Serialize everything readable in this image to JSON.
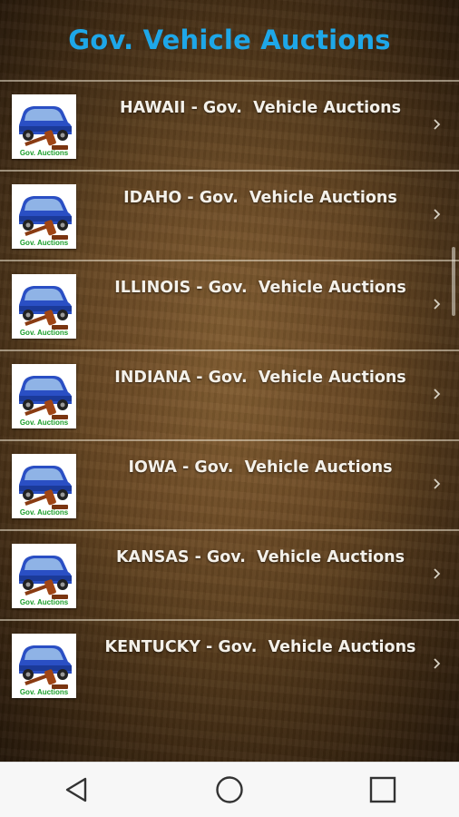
{
  "header": {
    "title": "Gov. Vehicle Auctions"
  },
  "items": [
    {
      "label": "HAWAII - Gov.  Vehicle Auctions",
      "thumb_text": "Gov. Auctions"
    },
    {
      "label": "IDAHO - Gov.  Vehicle Auctions",
      "thumb_text": "Gov. Auctions"
    },
    {
      "label": "ILLINOIS - Gov.  Vehicle Auctions",
      "thumb_text": "Gov. Auctions"
    },
    {
      "label": "INDIANA - Gov.  Vehicle Auctions",
      "thumb_text": "Gov. Auctions"
    },
    {
      "label": "IOWA - Gov.  Vehicle Auctions",
      "thumb_text": "Gov. Auctions"
    },
    {
      "label": "KANSAS - Gov.  Vehicle Auctions",
      "thumb_text": "Gov. Auctions"
    },
    {
      "label": "KENTUCKY - Gov.  Vehicle Auctions",
      "thumb_text": "Gov. Auctions"
    }
  ],
  "icons": {
    "row_chevron": "chevron-right-icon",
    "thumbnail": "car-gavel-icon",
    "nav_back": "back-triangle-icon",
    "nav_home": "home-circle-icon",
    "nav_recents": "recents-square-icon"
  },
  "colors": {
    "title": "#1ea7e8",
    "row_text": "#f4f1ea",
    "thumb_label": "#1a9e2a",
    "navbar": "#f7f7f7"
  }
}
